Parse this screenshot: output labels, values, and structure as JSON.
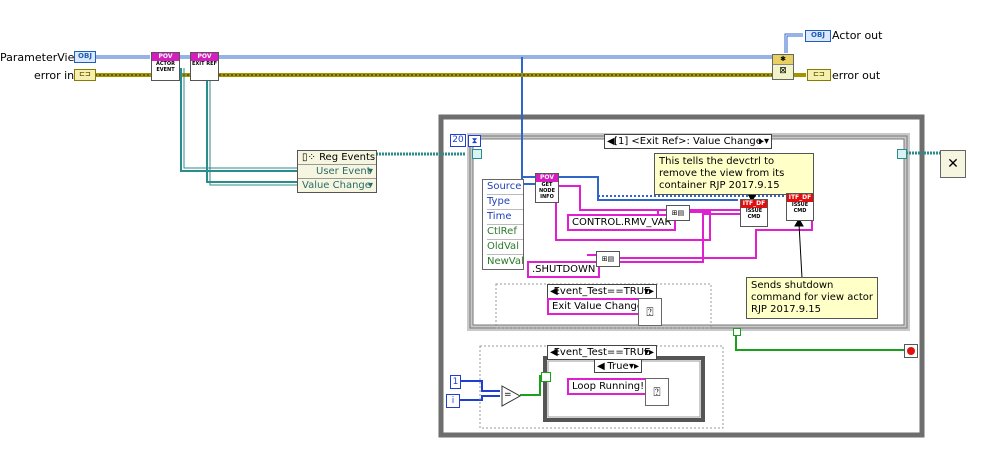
{
  "inputs": {
    "parameter_view_label": "ParameterView in",
    "error_in_label": "error in",
    "obj_tag": "OBJ"
  },
  "outputs": {
    "actor_out_label": "Actor out",
    "error_out_label": "error out"
  },
  "subvis": {
    "actor_event": {
      "hdr": "POV",
      "body": "ACTOR EVENT"
    },
    "exit_ref": {
      "hdr": "POV",
      "body": "EXIT REF"
    },
    "get_node_info": {
      "hdr": "POV",
      "body": "GET NODE INFO"
    },
    "issue_cmd_1": {
      "hdr": "ITF_DF",
      "body": "ISSUE CMD"
    },
    "issue_cmd_2": {
      "hdr": "ITF_DF",
      "body": "ISSUE CMD"
    }
  },
  "reg_events": {
    "title": "Reg Events",
    "rows": [
      "User Event",
      "Value Change"
    ]
  },
  "event_structure": {
    "timeout_value": "20",
    "case_selector": "[1] <Exit Ref>: Value Change",
    "data_items": [
      "Source",
      "Type",
      "Time",
      "CtlRef",
      "OldVal",
      "NewVal"
    ]
  },
  "strings": {
    "control_rmv_var": "CONTROL.RMV_VAR",
    "shutdown": ".SHUTDOWN",
    "exit_value_change": "Exit Value Change!!",
    "loop_running": "Loop Running!"
  },
  "comments": {
    "remove_view": "This tells the devctrl to remove the view from its container RJP 2017.9.15",
    "shutdown_cmd": "Sends shutdown command for view actor  RJP 2017.9.15"
  },
  "diagram_disables": {
    "inner": "Event_Test==TRUE",
    "outer": "Event_Test==TRUE",
    "case_true": "True"
  },
  "constants": {
    "numeric_one": "1",
    "loop_index": "i",
    "compare_op": "="
  },
  "colors": {
    "class_wire": "#2f66c8",
    "error_wire": "#a39400",
    "event_wire": "#2b8c8c",
    "string_wire": "#e020d0",
    "boolean_wire": "#1aa01a",
    "loop_frame": "#6e6e6e"
  }
}
